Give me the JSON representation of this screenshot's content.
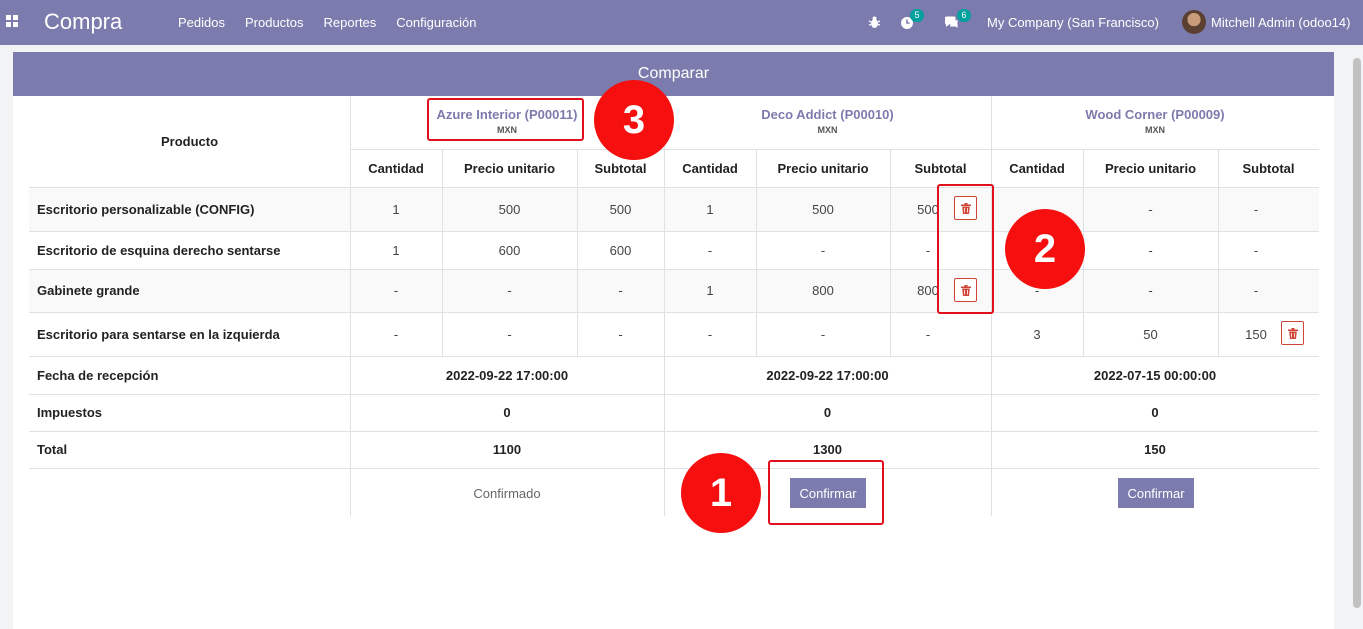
{
  "navbar": {
    "app_name": "Compra",
    "menu": [
      "Pedidos",
      "Productos",
      "Reportes",
      "Configuración"
    ],
    "activity_count": "5",
    "message_count": "6",
    "company": "My Company (San Francisco)",
    "user": "Mitchell Admin (odoo14)"
  },
  "dialog": {
    "title": "Comparar",
    "product_header": "Producto",
    "column_headers": [
      "Cantidad",
      "Precio unitario",
      "Subtotal"
    ],
    "vendors": [
      {
        "name": "Azure Interior (P00011)",
        "currency": "MXN"
      },
      {
        "name": "Deco Addict (P00010)",
        "currency": "MXN"
      },
      {
        "name": "Wood Corner (P00009)",
        "currency": "MXN"
      }
    ],
    "rows": [
      {
        "product": "Escritorio personalizable (CONFIG)",
        "cells": [
          "1",
          "500",
          "500",
          "1",
          "500",
          "500",
          "-",
          "-",
          "-"
        ]
      },
      {
        "product": "Escritorio de esquina derecho sentarse",
        "cells": [
          "1",
          "600",
          "600",
          "-",
          "-",
          "-",
          "-",
          "-",
          "-"
        ]
      },
      {
        "product": "Gabinete grande",
        "cells": [
          "-",
          "-",
          "-",
          "1",
          "800",
          "800",
          "-",
          "-",
          "-"
        ]
      },
      {
        "product": "Escritorio para sentarse en la izquierda",
        "cells": [
          "-",
          "-",
          "-",
          "-",
          "-",
          "-",
          "3",
          "50",
          "150"
        ]
      }
    ],
    "summary": [
      {
        "label": "Fecha de recepción",
        "values": [
          "2022-09-22 17:00:00",
          "2022-09-22 17:00:00",
          "2022-07-15 00:00:00"
        ]
      },
      {
        "label": "Impuestos",
        "values": [
          "0",
          "0",
          "0"
        ]
      },
      {
        "label": "Total",
        "values": [
          "1100",
          "1300",
          "150"
        ]
      }
    ],
    "actions": {
      "confirmed_label": "Confirmado",
      "confirm_label_2": "Confirmar",
      "confirm_label_3": "Confirmar"
    }
  },
  "annotations": {
    "marker_1": "1",
    "marker_2": "2",
    "marker_3": "3",
    "color": "#e2101c"
  },
  "colors": {
    "primary": "#7c7bad",
    "danger": "#d04437",
    "badge": "#00a09d"
  }
}
